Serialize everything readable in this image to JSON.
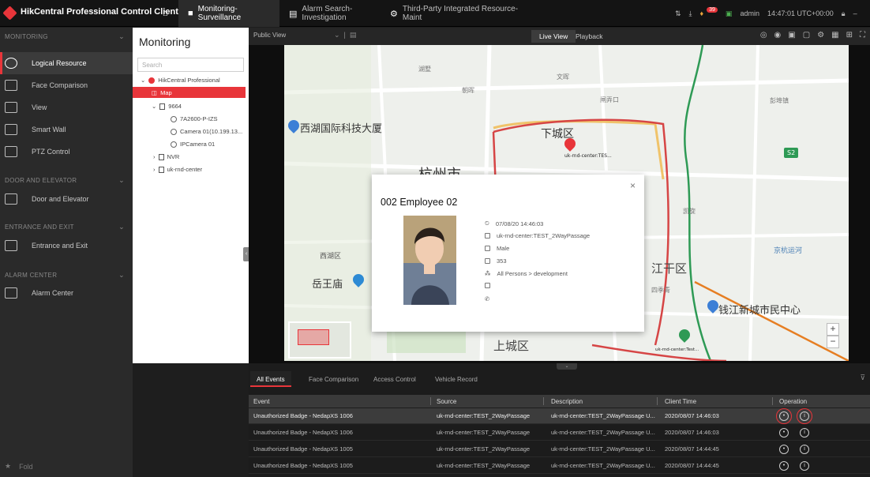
{
  "app": {
    "name": "HikCentral Professional Control Client"
  },
  "title_tabs": [
    {
      "label": "Monitoring-Surveillance"
    },
    {
      "label": "Alarm Search-Investigation"
    },
    {
      "label": "Third-Party Integrated Resource-Maint"
    }
  ],
  "title_right": {
    "notif_count": "39",
    "user": "admin",
    "time": "14:47:01 UTC+00:00"
  },
  "nav": {
    "sections": [
      {
        "label": "MONITORING"
      },
      {
        "label": "DOOR AND ELEVATOR"
      },
      {
        "label": "ENTRANCE AND EXIT"
      },
      {
        "label": "ALARM CENTER"
      }
    ],
    "items": [
      {
        "label": "Logical Resource"
      },
      {
        "label": "Face Comparison"
      },
      {
        "label": "View"
      },
      {
        "label": "Smart Wall"
      },
      {
        "label": "PTZ Control"
      },
      {
        "label": "Door and Elevator"
      },
      {
        "label": "Entrance and Exit"
      },
      {
        "label": "Alarm Center"
      }
    ],
    "fold": "Fold"
  },
  "resource": {
    "title": "Monitoring",
    "search_placeholder": "Search",
    "tree": [
      {
        "label": "HikCentral Professional"
      },
      {
        "label": "Map"
      },
      {
        "label": "9664"
      },
      {
        "label": "7A2600-P-IZS"
      },
      {
        "label": "Camera 01(10.199.13..."
      },
      {
        "label": "IPCamera 01"
      },
      {
        "label": "NVR"
      },
      {
        "label": "uk-rnd-center"
      }
    ]
  },
  "view_toolbar": {
    "public_view": "Public View",
    "live_view": "Live View",
    "playback": "Playback"
  },
  "map": {
    "labels": [
      {
        "text": "西湖国际科技大厦"
      },
      {
        "text": "下城区"
      },
      {
        "text": "uk-rnd-center:TES..."
      },
      {
        "text": "杭州市"
      },
      {
        "text": "西湖区"
      },
      {
        "text": "岳王庙"
      },
      {
        "text": "江干区"
      },
      {
        "text": "钱江新城市民中心"
      },
      {
        "text": "上城区"
      },
      {
        "text": "uk-rnd-center:Test..."
      },
      {
        "text": "文晖"
      },
      {
        "text": "朝晖"
      },
      {
        "text": "湖墅"
      },
      {
        "text": "彭埠镇"
      },
      {
        "text": "凯旋"
      },
      {
        "text": "四季青"
      },
      {
        "text": "京杭运河"
      },
      {
        "text": "S2"
      },
      {
        "text": "闸弄口"
      }
    ]
  },
  "popup": {
    "title": "002 Employee 02",
    "rows": [
      {
        "icon": "clock-icon",
        "text": "07/08/20 14:46:03"
      },
      {
        "icon": "door-icon",
        "text": "uk-rnd-center:TEST_2WayPassage"
      },
      {
        "icon": "gender-icon",
        "text": "Male"
      },
      {
        "icon": "id-card-icon",
        "text": "353"
      },
      {
        "icon": "org-icon",
        "text": "All Persons > development"
      },
      {
        "icon": "mail-icon",
        "text": ""
      },
      {
        "icon": "phone-icon",
        "text": ""
      }
    ]
  },
  "events": {
    "tabs": [
      {
        "label": "All Events"
      },
      {
        "label": "Face Comparison"
      },
      {
        "label": "Access Control"
      },
      {
        "label": "Vehicle Record"
      }
    ],
    "columns": [
      {
        "label": "Event"
      },
      {
        "label": "Source"
      },
      {
        "label": "Description"
      },
      {
        "label": "Client Time"
      },
      {
        "label": "Operation"
      }
    ],
    "rows": [
      {
        "event": "Unauthorized Badge - NedapXS 1006",
        "source": "uk-rnd-center:TEST_2WayPassage",
        "description": "uk-rnd-center:TEST_2WayPassage U...",
        "time": "2020/08/07 14:46:03"
      },
      {
        "event": "Unauthorized Badge - NedapXS 1006",
        "source": "uk-rnd-center:TEST_2WayPassage",
        "description": "uk-rnd-center:TEST_2WayPassage U...",
        "time": "2020/08/07 14:46:03"
      },
      {
        "event": "Unauthorized Badge - NedapXS 1005",
        "source": "uk-rnd-center:TEST_2WayPassage",
        "description": "uk-rnd-center:TEST_2WayPassage U...",
        "time": "2020/08/07 14:44:45"
      },
      {
        "event": "Unauthorized Badge - NedapXS 1005",
        "source": "uk-rnd-center:TEST_2WayPassage",
        "description": "uk-rnd-center:TEST_2WayPassage U...",
        "time": "2020/08/07 14:44:45"
      }
    ]
  },
  "colors": {
    "accent": "#e8353a",
    "panel": "#2a2a2a",
    "bg": "#1e1e1e"
  }
}
